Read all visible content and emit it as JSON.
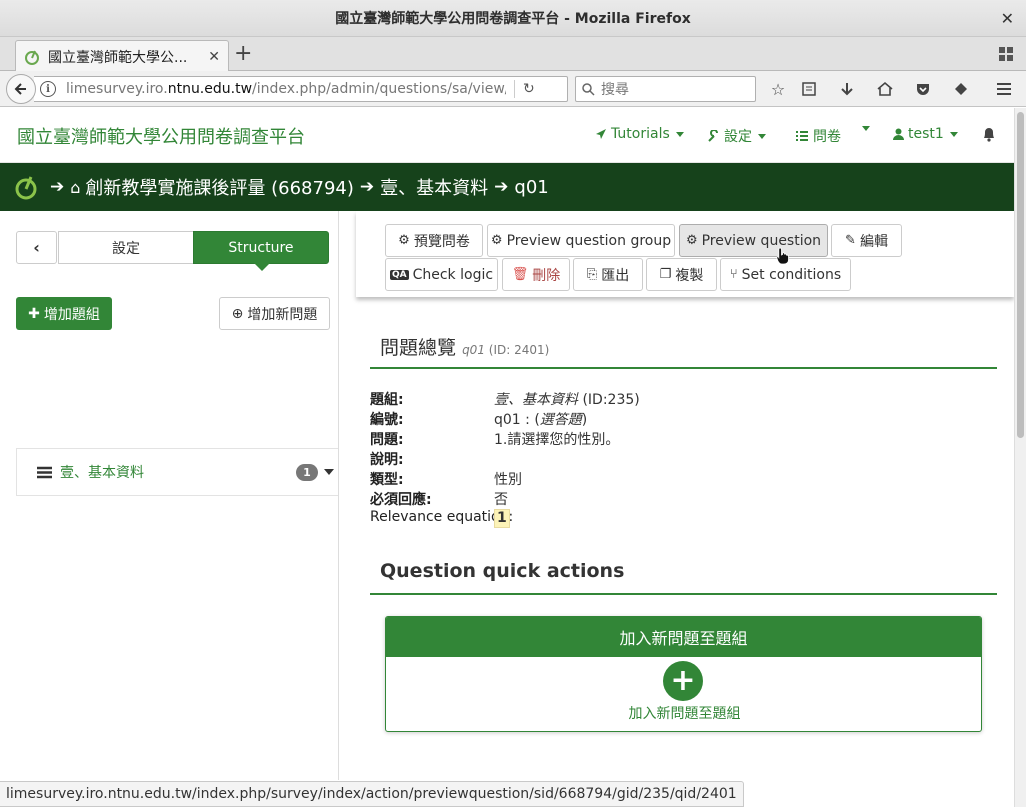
{
  "window": {
    "title": "國立臺灣師範大學公用問卷調查平台 - Mozilla Firefox",
    "close_glyph": "✕"
  },
  "browser": {
    "tab_label": "國立臺灣師範大學公...",
    "tab_close": "✕",
    "new_tab": "+",
    "url_host_pre": "limesurvey.iro.",
    "url_host_main": "ntnu.edu.tw",
    "url_path": "/index.php/admin/questions/sa/view/surve",
    "search_placeholder": "搜尋",
    "status_url": "limesurvey.iro.ntnu.edu.tw/index.php/survey/index/action/previewquestion/sid/668794/gid/235/qid/2401"
  },
  "topnav": {
    "brand": "國立臺灣師範大學公用問卷調查平台",
    "tutorials": "Tutorials",
    "settings": "設定",
    "surveys": "問卷",
    "user": "test1"
  },
  "breadcrumb": {
    "survey": "創新教學實施課後評量 (668794)",
    "group": "壹、基本資料",
    "question": "q01"
  },
  "sidebar": {
    "tab_settings": "設定",
    "tab_structure": "Structure",
    "add_group": "增加題組",
    "add_question": "增加新問題",
    "group_name": "壹、基本資料",
    "group_count": "1"
  },
  "toolbar": {
    "preview_survey": "預覽問卷",
    "preview_group": "Preview question group",
    "preview_question": "Preview question",
    "edit": "編輯",
    "check_logic": "Check logic",
    "delete": "刪除",
    "export": "匯出",
    "copy": "複製",
    "set_conditions": "Set conditions"
  },
  "overview": {
    "heading": "問題總覽",
    "code_italic": "q01",
    "id_text": "(ID: 2401)",
    "rows": {
      "group_k": "題組:",
      "group_name": "壹、基本資料",
      "group_id": "(ID:235)",
      "code_k": "編號:",
      "code_v": "q01 : (",
      "code_required": "選答題",
      "code_close": ")",
      "question_k": "問題:",
      "question_v": "1.請選擇您的性別。",
      "help_k": "說明:",
      "help_v": "",
      "type_k": "類型:",
      "type_v": "性別",
      "mandatory_k": "必須回應:",
      "mandatory_v": "否",
      "relevance_k": "Relevance equation:",
      "relevance_v": "1"
    }
  },
  "quick_actions": {
    "heading": "Question quick actions",
    "panel_title": "加入新問題至題組",
    "panel_label": "加入新問題至題組"
  },
  "colors": {
    "brand_green": "#328637",
    "breadcrumb_bg": "#16421b",
    "delete_red": "#d9534f"
  }
}
